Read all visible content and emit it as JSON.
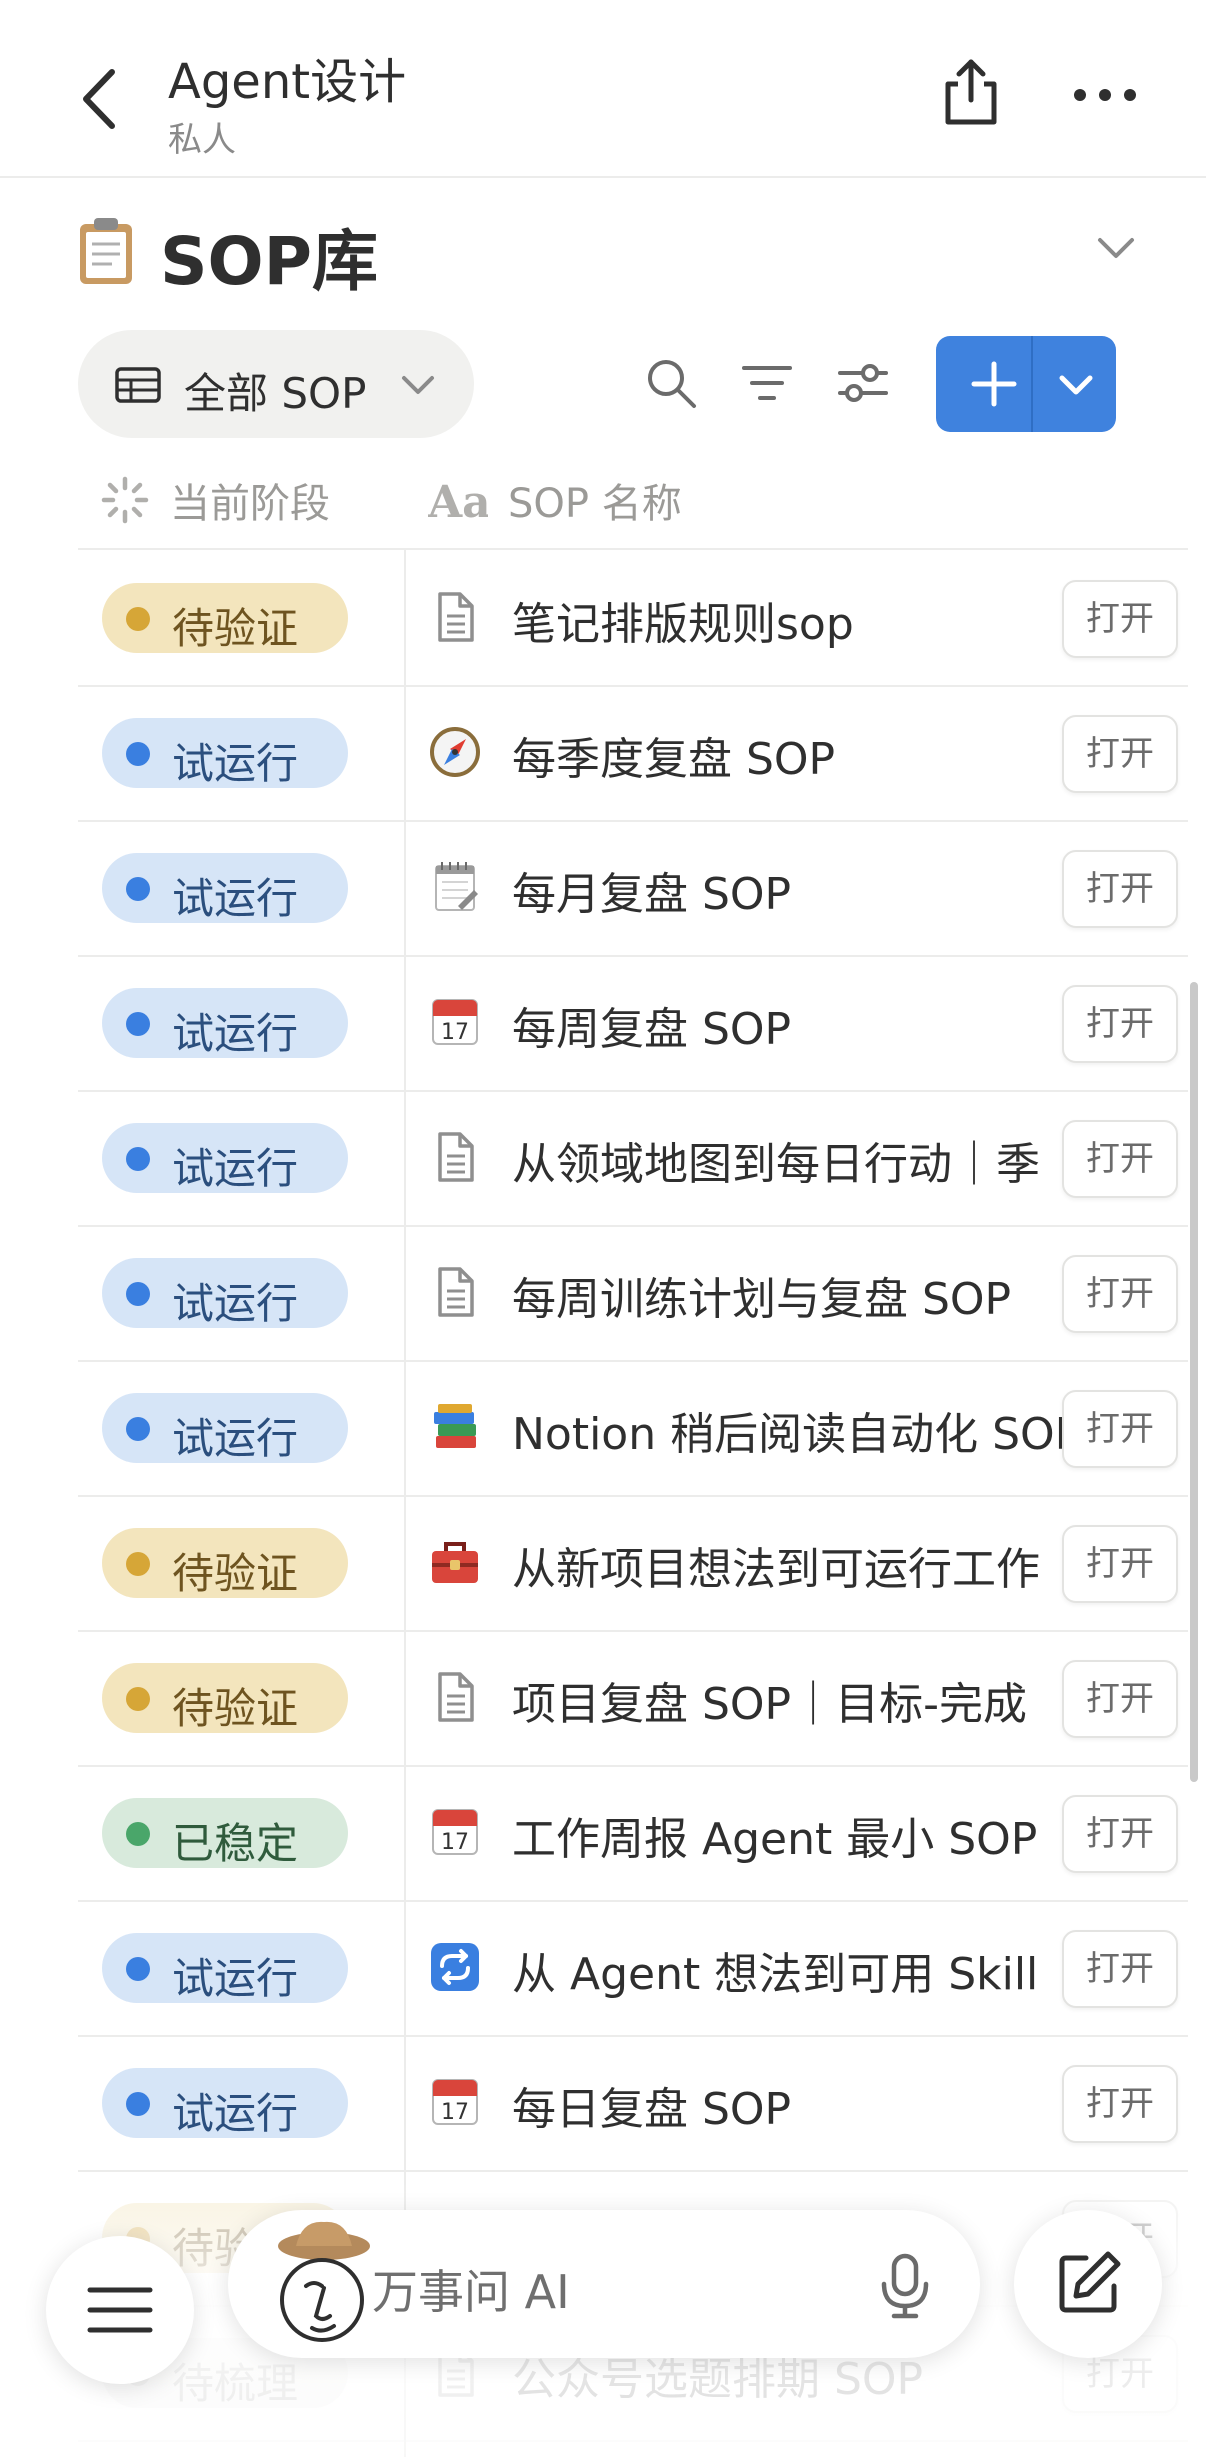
{
  "header": {
    "title": "Agent设计",
    "subtitle": "私人"
  },
  "section": {
    "title": "SOP库"
  },
  "toolbar": {
    "view_label": "全部 SOP"
  },
  "columns": {
    "stage": "当前阶段",
    "name": "SOP 名称"
  },
  "open_label": "打开",
  "rows": [
    {
      "status": "待验证",
      "name": "笔记排版规则sop"
    },
    {
      "status": "试运行",
      "name": "每季度复盘 SOP"
    },
    {
      "status": "试运行",
      "name": "每月复盘 SOP"
    },
    {
      "status": "试运行",
      "name": "每周复盘 SOP"
    },
    {
      "status": "试运行",
      "name": "从领域地图到每日行动｜季"
    },
    {
      "status": "试运行",
      "name": "每周训练计划与复盘 SOP"
    },
    {
      "status": "试运行",
      "name": "Notion 稍后阅读自动化 SOP"
    },
    {
      "status": "待验证",
      "name": "从新项目想法到可运行工作"
    },
    {
      "status": "待验证",
      "name": "项目复盘 SOP｜目标-完成"
    },
    {
      "status": "已稳定",
      "name": "工作周报 Agent 最小 SOP"
    },
    {
      "status": "试运行",
      "name": "从 Agent 想法到可用 Skill"
    },
    {
      "status": "试运行",
      "name": "每日复盘 SOP"
    },
    {
      "status": "待验证",
      "name": ""
    },
    {
      "status": "待梳理",
      "name": "公众号选题排期 SOP"
    }
  ],
  "ai_bar": {
    "placeholder": "万事问 AI"
  },
  "status_colors": {
    "待验证": {
      "bg": "#f3e5bd",
      "dot": "#d6a637",
      "text": "#6e5420"
    },
    "试运行": {
      "bg": "#d6e5f7",
      "dot": "#3a7fe0",
      "text": "#2b4f7e"
    },
    "已稳定": {
      "bg": "#d8eadc",
      "dot": "#4aa66a",
      "text": "#2f5b3c"
    },
    "待梳理": {
      "bg": "#ececea",
      "dot": "#b4b4b2",
      "text": "#8e8e8c"
    }
  },
  "row_icons": [
    "page-icon",
    "compass-icon",
    "notepad-icon",
    "calendar-icon",
    "page-icon",
    "page-icon",
    "books-icon",
    "toolbox-icon",
    "page-icon",
    "calendar-icon",
    "repeat-icon",
    "calendar-icon",
    "page-icon",
    "page-icon"
  ]
}
